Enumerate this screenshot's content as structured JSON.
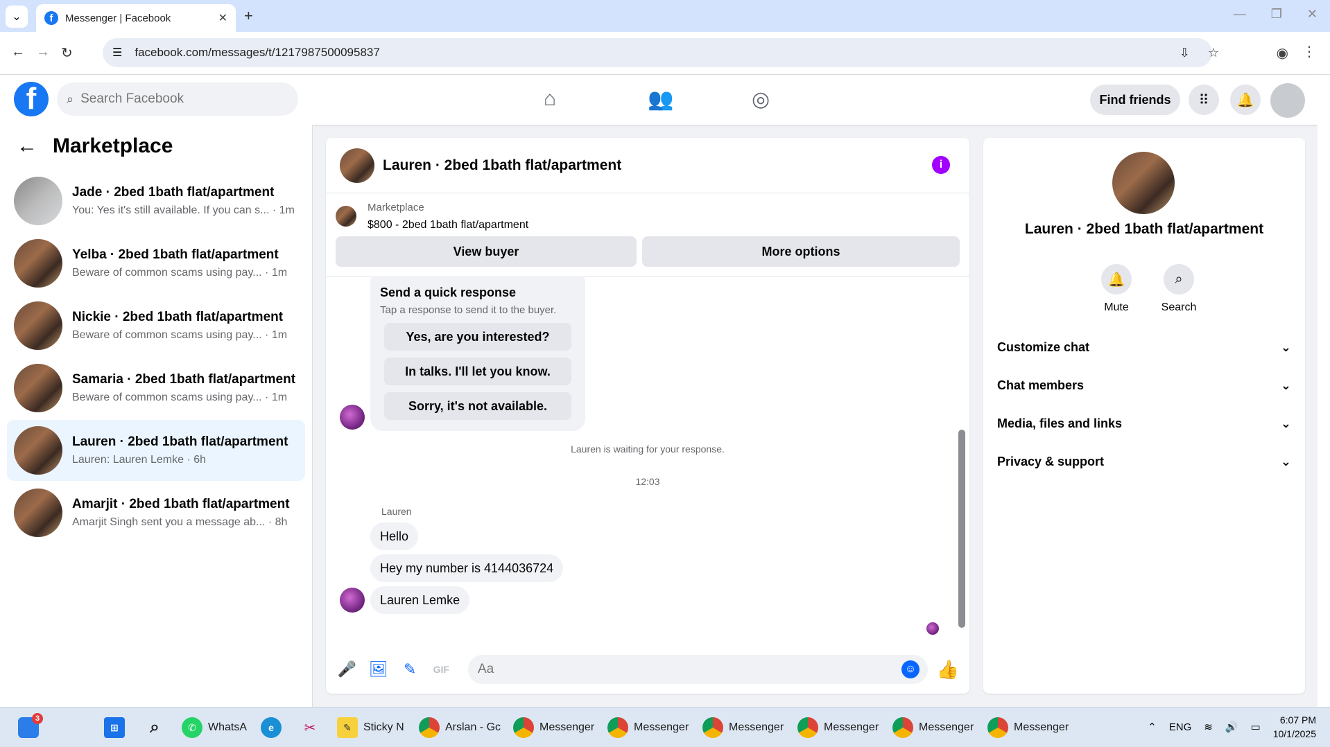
{
  "browser": {
    "tab_title": "Messenger | Facebook",
    "url": "facebook.com/messages/t/1217987500095837"
  },
  "fb": {
    "search_placeholder": "Search Facebook",
    "find_friends": "Find friends"
  },
  "sidebar": {
    "title": "Marketplace",
    "conversations": [
      {
        "name": "Jade · 2bed 1bath flat/apartment",
        "preview": "You: Yes it's still available. If you can s... · 1m"
      },
      {
        "name": "Yelba · 2bed 1bath flat/apartment",
        "preview": "Beware of common scams using pay... · 1m"
      },
      {
        "name": "Nickie · 2bed 1bath flat/apartment",
        "preview": "Beware of common scams using pay... · 1m"
      },
      {
        "name": "Samaria · 2bed 1bath flat/apartment",
        "preview": "Beware of common scams using pay... · 1m"
      },
      {
        "name": "Lauren · 2bed 1bath flat/apartment",
        "preview": "Lauren: Lauren Lemke · 6h"
      },
      {
        "name": "Amarjit · 2bed 1bath flat/apartment",
        "preview": "Amarjit Singh sent you a message ab... · 8h"
      }
    ]
  },
  "chat": {
    "title": "Lauren · 2bed 1bath flat/apartment",
    "marketplace_label": "Marketplace",
    "listing": "$800 - 2bed 1bath flat/apartment",
    "view_buyer": "View buyer",
    "more_options": "More options",
    "quick_title": "Send a quick response",
    "quick_sub": "Tap a response to send it to the buyer.",
    "quick_options": [
      "Yes, are you interested?",
      "In talks. I'll let you know.",
      "Sorry, it's not available."
    ],
    "waiting_note": "Lauren is waiting for your response.",
    "timestamp": "12:03",
    "sender": "Lauren",
    "messages": [
      "Hello",
      "Hey my number is 4144036724",
      "Lauren Lemke"
    ],
    "composer_placeholder": "Aa"
  },
  "details": {
    "name": "Lauren · 2bed 1bath flat/apartment",
    "mute": "Mute",
    "search": "Search",
    "sections": [
      "Customize chat",
      "Chat members",
      "Media, files and links",
      "Privacy & support"
    ]
  },
  "taskbar": {
    "badge": "3",
    "items": [
      "WhatsA",
      "Sticky N",
      "Arslan - Gc",
      "Messenger",
      "Messenger",
      "Messenger",
      "Messenger",
      "Messenger",
      "Messenger"
    ],
    "lang": "ENG",
    "time": "6:07 PM",
    "date": "10/1/2025"
  },
  "colors": {
    "fb_blue": "#1877f2",
    "messenger_blue": "#0866ff",
    "info_purple": "#a200ff"
  }
}
